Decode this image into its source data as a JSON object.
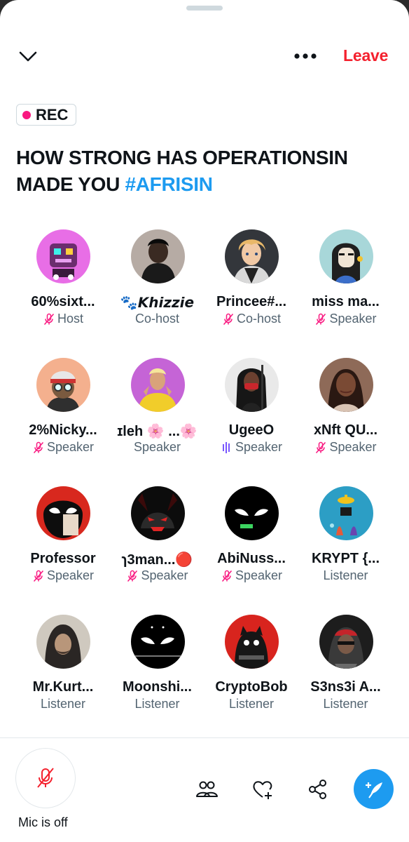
{
  "header": {
    "leave_label": "Leave"
  },
  "rec_badge": {
    "label": "REC"
  },
  "title": {
    "text": "HOW STRONG HAS OPERATIONSIN MADE YOU ",
    "hashtag": "#AFRISIN"
  },
  "participants": [
    {
      "name": "60%sixt...",
      "role": "Host",
      "status": "muted",
      "avatar": "pink-robot"
    },
    {
      "name": "🐾𝙆𝙝𝙞𝙯𝙯𝙞𝙚",
      "role": "Co-host",
      "status": "none",
      "avatar": "dark-hoodie"
    },
    {
      "name": "Princee#...",
      "role": "Co-host",
      "status": "muted",
      "avatar": "anime-boy"
    },
    {
      "name": "miss ma...",
      "role": "Speaker",
      "status": "muted",
      "avatar": "goth-girl"
    },
    {
      "name": "2%Nicky...",
      "role": "Speaker",
      "status": "muted",
      "avatar": "helmet-ape"
    },
    {
      "name": "ɪleh 🌸 ...🌸",
      "role": "Speaker",
      "status": "none",
      "avatar": "yellow-jacket"
    },
    {
      "name": "UgeeO",
      "role": "Speaker",
      "status": "talking",
      "avatar": "masked-girl"
    },
    {
      "name": "xNft QU...",
      "role": "Speaker",
      "status": "muted",
      "avatar": "selfie-woman"
    },
    {
      "name": "Professor",
      "role": "Speaker",
      "status": "muted",
      "avatar": "venom-face"
    },
    {
      "name": "ɿ3man...🔴",
      "role": "Speaker",
      "status": "muted",
      "avatar": "red-demon"
    },
    {
      "name": "AbiNuss...",
      "role": "Speaker",
      "status": "muted",
      "avatar": "glowing-eyes"
    },
    {
      "name": "KRYPT {...",
      "role": "Listener",
      "status": "none",
      "avatar": "underwater"
    },
    {
      "name": "Mr.Kurt...",
      "role": "Listener",
      "status": "none",
      "avatar": "hooded-man"
    },
    {
      "name": "Moonshi...",
      "role": "Listener",
      "status": "none",
      "avatar": "moonshine-eyes"
    },
    {
      "name": "CryptoBob",
      "role": "Listener",
      "status": "none",
      "avatar": "red-cat"
    },
    {
      "name": "S3ns3i A...",
      "role": "Listener",
      "status": "none",
      "avatar": "red-hood"
    }
  ],
  "bottom_bar": {
    "mic_label": "Mic is off"
  },
  "colors": {
    "accent": "#1d9bf0",
    "leave": "#f4212e",
    "muted_icon": "#f91880",
    "text": "#0f1419",
    "secondary": "#536471"
  }
}
